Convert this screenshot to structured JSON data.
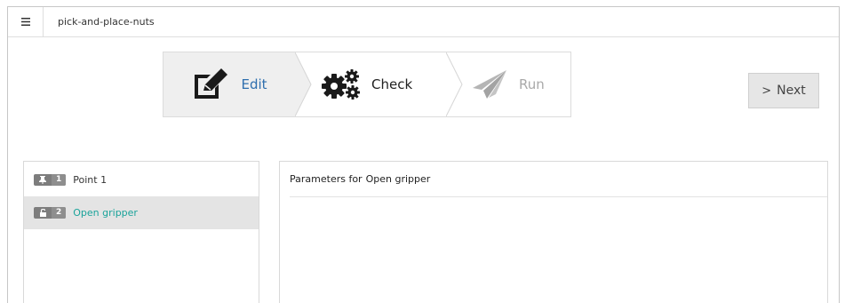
{
  "app": {
    "menu_icon": "hamburger-icon",
    "project_name": "pick-and-place-nuts"
  },
  "wizard": {
    "steps": [
      {
        "label": "Edit",
        "icon": "edit-icon",
        "state": "active"
      },
      {
        "label": "Check",
        "icon": "gears-icon",
        "state": "enabled"
      },
      {
        "label": "Run",
        "icon": "paper-plane-icon",
        "state": "disabled"
      }
    ],
    "next_button": {
      "arrow": ">",
      "label": "Next"
    }
  },
  "program": {
    "items": [
      {
        "icon": "pin-icon",
        "number": "1",
        "label": "Point 1",
        "selected": false
      },
      {
        "icon": "unlock-icon",
        "number": "2",
        "label": "Open gripper",
        "selected": true
      }
    ]
  },
  "parameters": {
    "prefix": "Parameters for",
    "target": "Open gripper"
  },
  "colors": {
    "accent_blue": "#2f6fae",
    "selected_teal": "#1aa39a",
    "badge_gray": "#7d7d7d",
    "disabled_gray": "#a9a9a9"
  }
}
